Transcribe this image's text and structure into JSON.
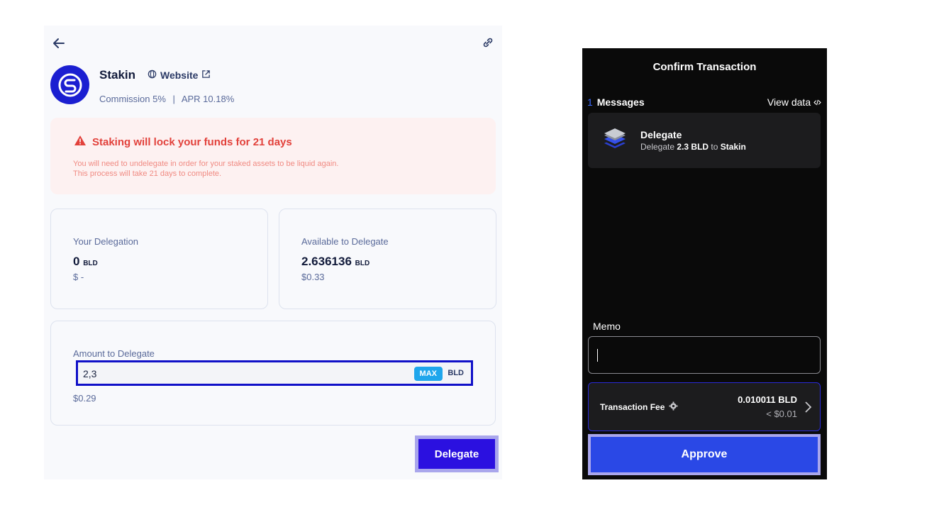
{
  "validator": {
    "name": "Stakin",
    "website_label": "Website",
    "commission": "Commission 5%",
    "separator": "|",
    "apr": "APR 10.18%"
  },
  "warning": {
    "title": "Staking will lock your funds for 21 days",
    "line1": "You will need to undelegate in order for your staked assets to be liquid again.",
    "line2": "This process will take 21 days to complete."
  },
  "your_delegation": {
    "label": "Your Delegation",
    "value": "0",
    "unit": "BLD",
    "usd": "$ -"
  },
  "available": {
    "label": "Available to Delegate",
    "value": "2.636136",
    "unit": "BLD",
    "usd": "$0.33"
  },
  "amount": {
    "label": "Amount to Delegate",
    "value": "2,3",
    "max_label": "MAX",
    "unit": "BLD",
    "usd": "$0.29"
  },
  "delegate_button": "Delegate",
  "confirm": {
    "title": "Confirm Transaction",
    "messages_count": "1",
    "messages_label": "Messages",
    "view_data": "View data",
    "message": {
      "title": "Delegate",
      "prefix": "Delegate",
      "amount": "2.3 BLD",
      "to": "to",
      "validator": "Stakin"
    },
    "memo_label": "Memo",
    "fee_label": "Transaction Fee",
    "fee_value": "0.010011 BLD",
    "fee_usd": "< $0.01",
    "approve": "Approve"
  },
  "colors": {
    "accent": "#2b10e0",
    "warning": "#e2413b",
    "approve": "#2a48e6"
  }
}
